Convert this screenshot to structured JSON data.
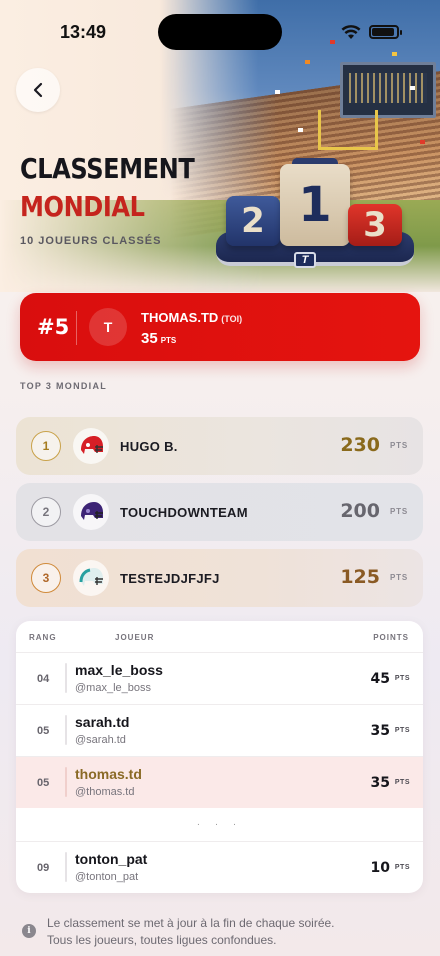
{
  "status_bar": {
    "time": "13:49"
  },
  "header": {
    "title_line1": "CLASSEMENT",
    "title_line2": "MONDIAL",
    "subtitle": "10 JOUEURS CLASSÉS"
  },
  "podium": {
    "labels": [
      "2",
      "1",
      "3"
    ],
    "logo": "T"
  },
  "me": {
    "rank": "#5",
    "avatar_initial": "T",
    "name": "THOMAS.TD",
    "tag": "(TOI)",
    "points": "35",
    "points_unit": "PTS"
  },
  "top3": {
    "label": "TOP 3 MONDIAL",
    "items": [
      {
        "rank": "1",
        "name": "HUGO B.",
        "points": "230",
        "unit": "PTS",
        "helmet_color": "#d61f26",
        "rank_color": "#b88a2a",
        "points_color": "#8a6a1c"
      },
      {
        "rank": "2",
        "name": "TOUCHDOWNTEAM",
        "points": "200",
        "unit": "PTS",
        "helmet_color": "#4b2a86",
        "rank_color": "#8a8890",
        "points_color": "#6b6a72"
      },
      {
        "rank": "3",
        "name": "TESTEJDJFJFJ",
        "points": "125",
        "unit": "PTS",
        "helmet_color": "#2aa3a3",
        "rank_color": "#c27a2a",
        "points_color": "#8a5a24"
      }
    ]
  },
  "table": {
    "headers": {
      "rank": "RANG",
      "player": "JOUEUR",
      "points": "POINTS"
    },
    "rows": [
      {
        "rank": "04",
        "name": "max_le_boss",
        "handle": "@max_le_boss",
        "points": "45",
        "unit": "PTS"
      },
      {
        "rank": "05",
        "name": "sarah.td",
        "handle": "@sarah.td",
        "points": "35",
        "unit": "PTS"
      },
      {
        "rank": "05",
        "name": "thomas.td",
        "handle": "@thomas.td",
        "points": "35",
        "unit": "PTS"
      },
      {
        "rank": "09",
        "name": "tonton_pat",
        "handle": "@tonton_pat",
        "points": "10",
        "unit": "PTS"
      }
    ],
    "ellipsis": "· · ·"
  },
  "footer": {
    "info_icon": "i",
    "line1": "Le classement se met à jour à la fin de chaque soirée.",
    "line2": "Tous les joueurs, toutes ligues confondues."
  },
  "colors": {
    "brand_red": "#e0110f",
    "accent_red": "#c5241d"
  }
}
